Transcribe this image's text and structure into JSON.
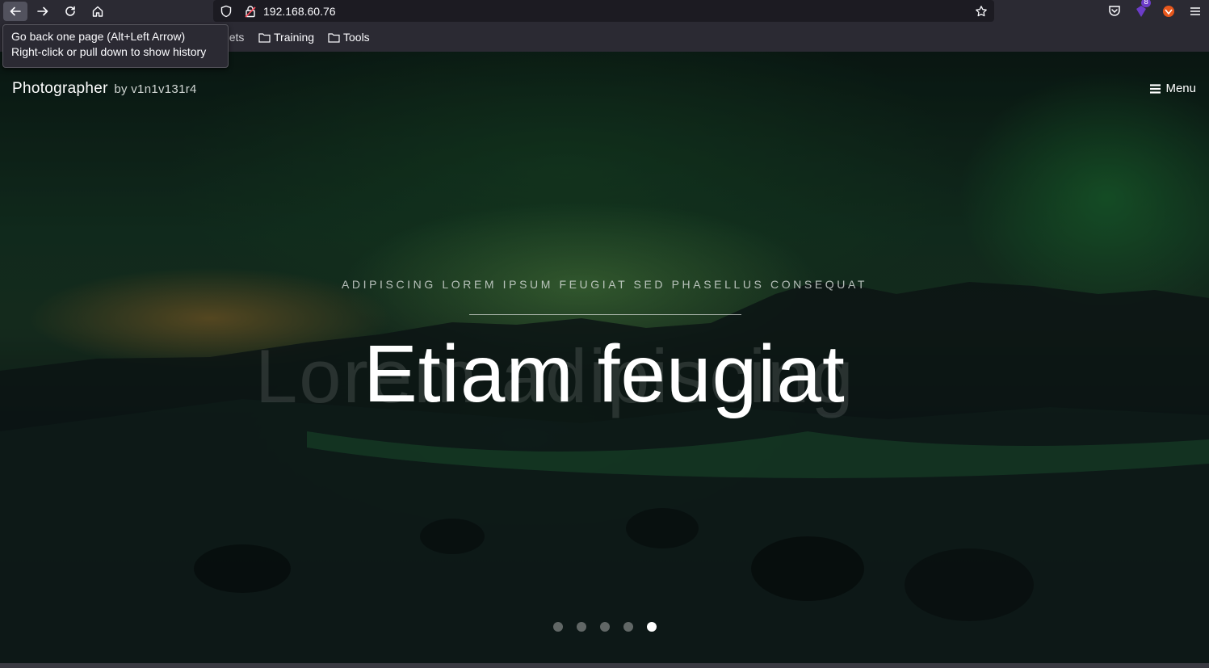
{
  "browser": {
    "url": "192.168.60.76",
    "extension_badge": "8",
    "tooltip": {
      "line1": "Go back one page (Alt+Left Arrow)",
      "line2": "Right-click or pull down to show history"
    },
    "bookmarks": [
      {
        "label": "heat sheets"
      },
      {
        "label": "Training"
      },
      {
        "label": "Tools"
      }
    ]
  },
  "page": {
    "brand": "Photographer",
    "brand_by": "by v1n1v131r4",
    "menu_label": "Menu",
    "subtitle": "ADIPISCING LOREM IPSUM FEUGIAT SED PHASELLUS CONSEQUAT",
    "ghost_title": "Lorem adipiscing",
    "title": "Etiam feugiat",
    "slides": 5,
    "active_slide": 5
  }
}
